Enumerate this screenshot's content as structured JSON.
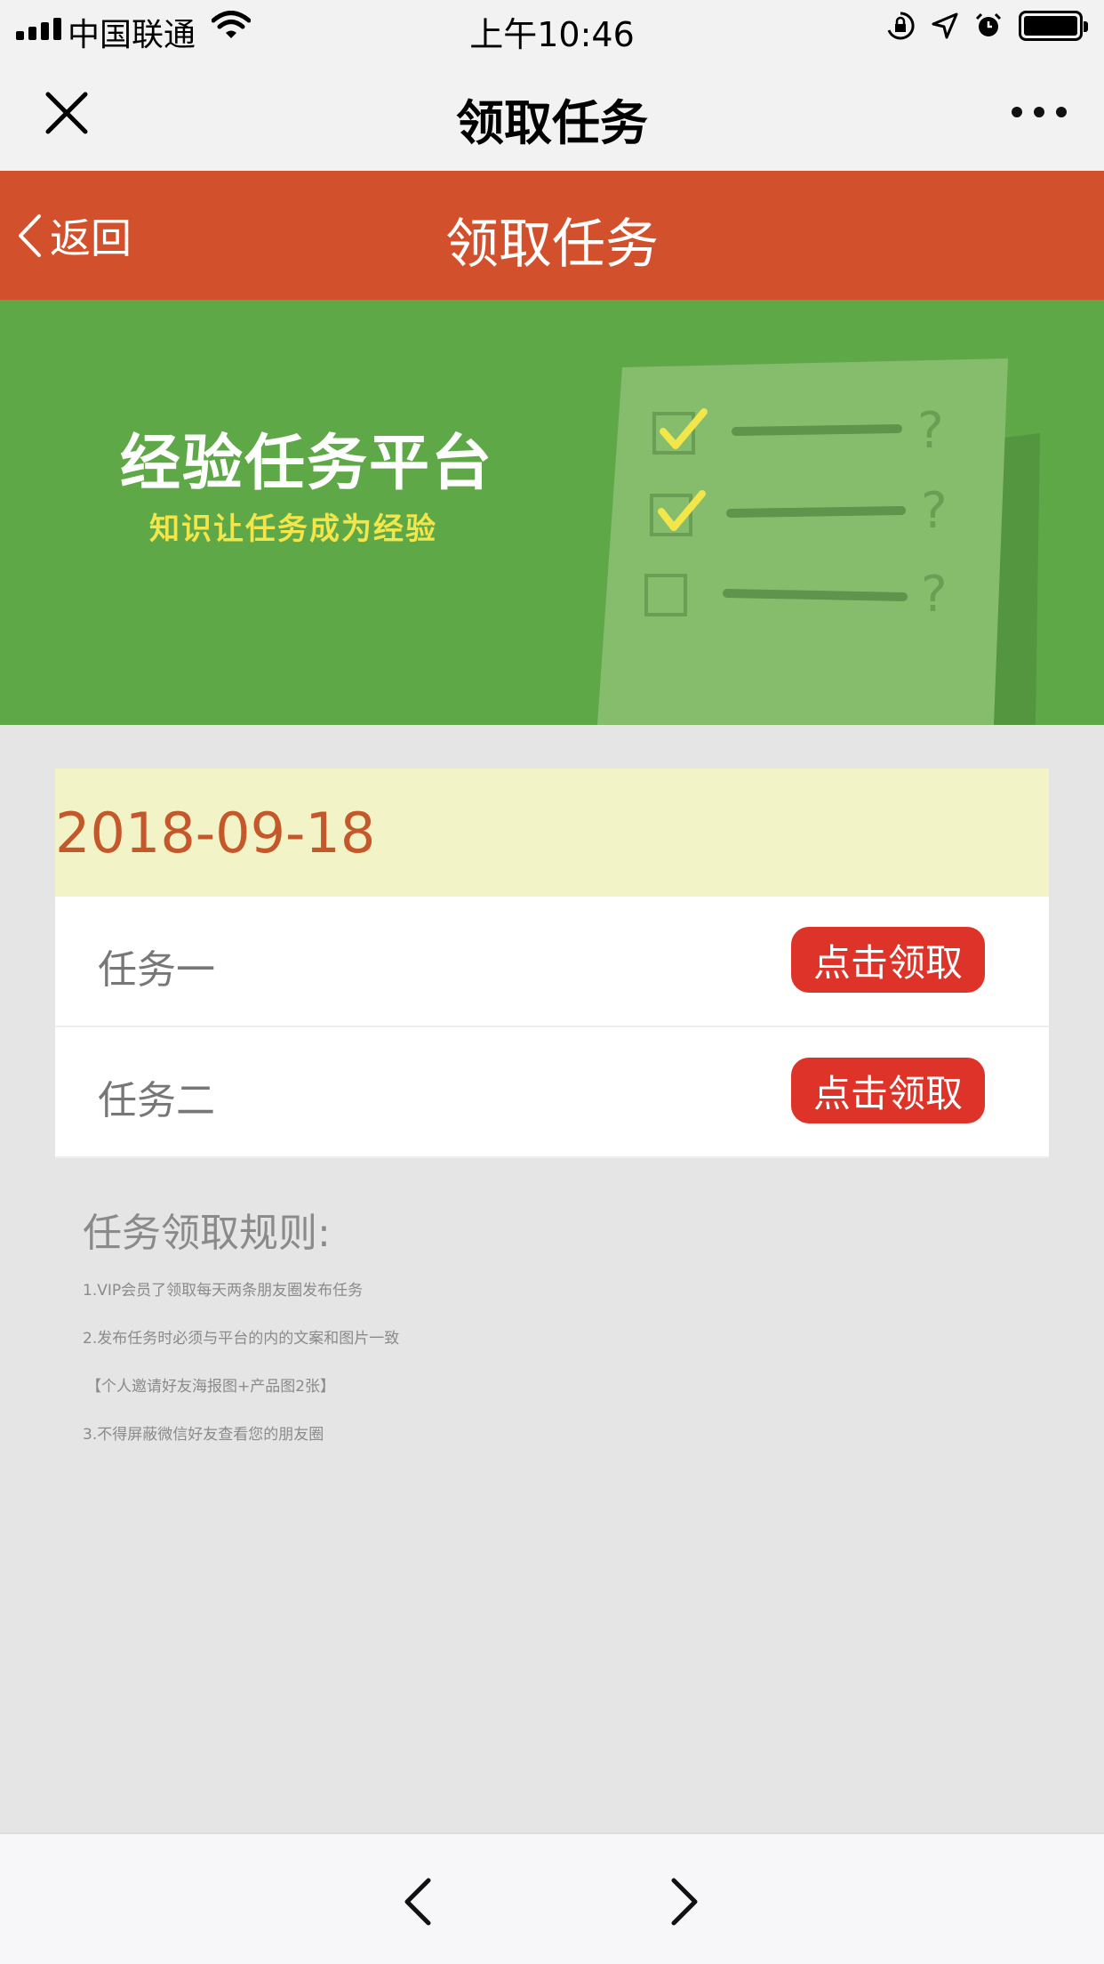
{
  "status_bar": {
    "carrier": "中国联通",
    "time": "上午10:46"
  },
  "wechat_nav": {
    "title": "领取任务"
  },
  "app_header": {
    "back_label": "返回",
    "title": "领取任务"
  },
  "banner": {
    "heading": "经验任务平台",
    "subheading": "知识让任务成为经验"
  },
  "task_list": {
    "date": "2018-09-18",
    "tasks": [
      {
        "name": "任务一",
        "button_label": "点击领取"
      },
      {
        "name": "任务二",
        "button_label": "点击领取"
      }
    ]
  },
  "rules": {
    "title": "任务领取规则:",
    "items": [
      "1.VIP会员了领取每天两条朋友圈发布任务",
      "2.发布任务时必须与平台的内的文案和图片一致",
      "【个人邀请好友海报图+产品图2张】",
      "3.不得屏蔽微信好友查看您的朋友圈"
    ]
  },
  "colors": {
    "header": "#d2502b",
    "banner": "#5fa848",
    "claim_button": "#dd3328",
    "date_bar": "#f3f3c8",
    "date_text": "#c4582b"
  }
}
